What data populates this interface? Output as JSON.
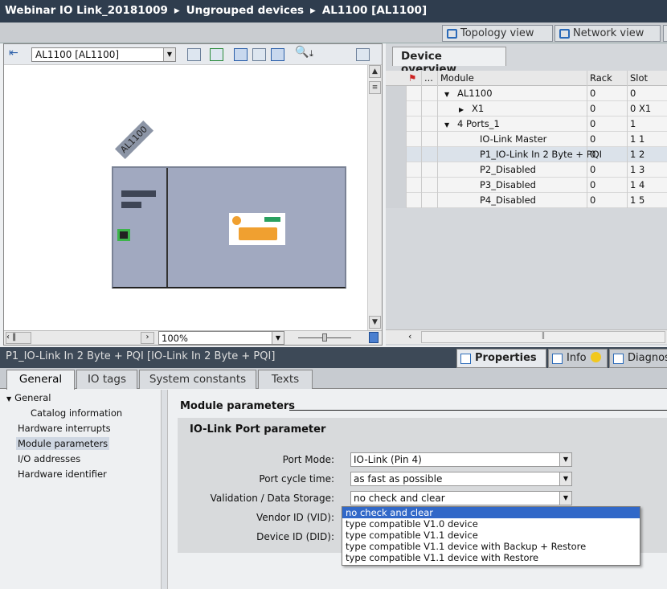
{
  "breadcrumb": [
    "Webinar IO Link_20181009",
    "Ungrouped devices",
    "AL1100 [AL1100]"
  ],
  "breadcrumb_sep": "▸",
  "views": {
    "topology": "Topology view",
    "network": "Network view"
  },
  "device_view": {
    "device_select": "AL1100 [AL1100]",
    "device_label": "AL1100",
    "zoom": "100%"
  },
  "device_overview": {
    "tab": "Device overview",
    "columns": {
      "module": "Module",
      "rack": "Rack",
      "slot": "Slot",
      "more": "..."
    },
    "rows": [
      {
        "module": "AL1100",
        "rack": "0",
        "slot": "0",
        "expander": "▼",
        "level": 0
      },
      {
        "module": "X1",
        "rack": "0",
        "slot": "0 X1",
        "expander": "▶",
        "level": 1
      },
      {
        "module": "4 Ports_1",
        "rack": "0",
        "slot": "1",
        "expander": "▼",
        "level": 0
      },
      {
        "module": "IO-Link Master",
        "rack": "0",
        "slot": "1 1",
        "expander": "",
        "level": 1
      },
      {
        "module": "P1_IO-Link In  2 Byte + PQI",
        "rack": "0",
        "slot": "1 2",
        "expander": "",
        "level": 1,
        "selected": true
      },
      {
        "module": "P2_Disabled",
        "rack": "0",
        "slot": "1 3",
        "expander": "",
        "level": 1
      },
      {
        "module": "P3_Disabled",
        "rack": "0",
        "slot": "1 4",
        "expander": "",
        "level": 1
      },
      {
        "module": "P4_Disabled",
        "rack": "0",
        "slot": "1 5",
        "expander": "",
        "level": 1
      }
    ]
  },
  "inspector": {
    "title": "P1_IO-Link In  2 Byte + PQI [IO-Link In  2 Byte + PQI]",
    "tabs": {
      "properties": "Properties",
      "info": "Info",
      "diagnostics": "Diagnos"
    },
    "subtabs": [
      "General",
      "IO tags",
      "System constants",
      "Texts"
    ],
    "tree": [
      {
        "label": "General",
        "expander": "▼"
      },
      {
        "label": "Catalog information"
      },
      {
        "label": "Hardware interrupts"
      },
      {
        "label": "Module parameters",
        "selected": true
      },
      {
        "label": "I/O addresses"
      },
      {
        "label": "Hardware identifier"
      }
    ]
  },
  "module_params": {
    "heading": "Module parameters",
    "section": "IO-Link Port parameter",
    "fields": [
      {
        "label": "Port Mode:",
        "value": "IO-Link (Pin 4)"
      },
      {
        "label": "Port cycle time:",
        "value": "as fast as possible"
      },
      {
        "label": "Validation / Data Storage:",
        "value": "no check and clear"
      },
      {
        "label": "Vendor ID (VID):"
      },
      {
        "label": "Device ID (DID):"
      }
    ],
    "dropdown_options": [
      "no check and clear",
      "type compatible V1.0 device",
      "type compatible V1.1 device",
      "type compatible V1.1 device with Backup + Restore",
      "type compatible V1.1 device with Restore"
    ]
  },
  "colors": {
    "selection": "#3168c8",
    "title_bar": "#2f3d4e",
    "rack": "#a1a9c0"
  }
}
